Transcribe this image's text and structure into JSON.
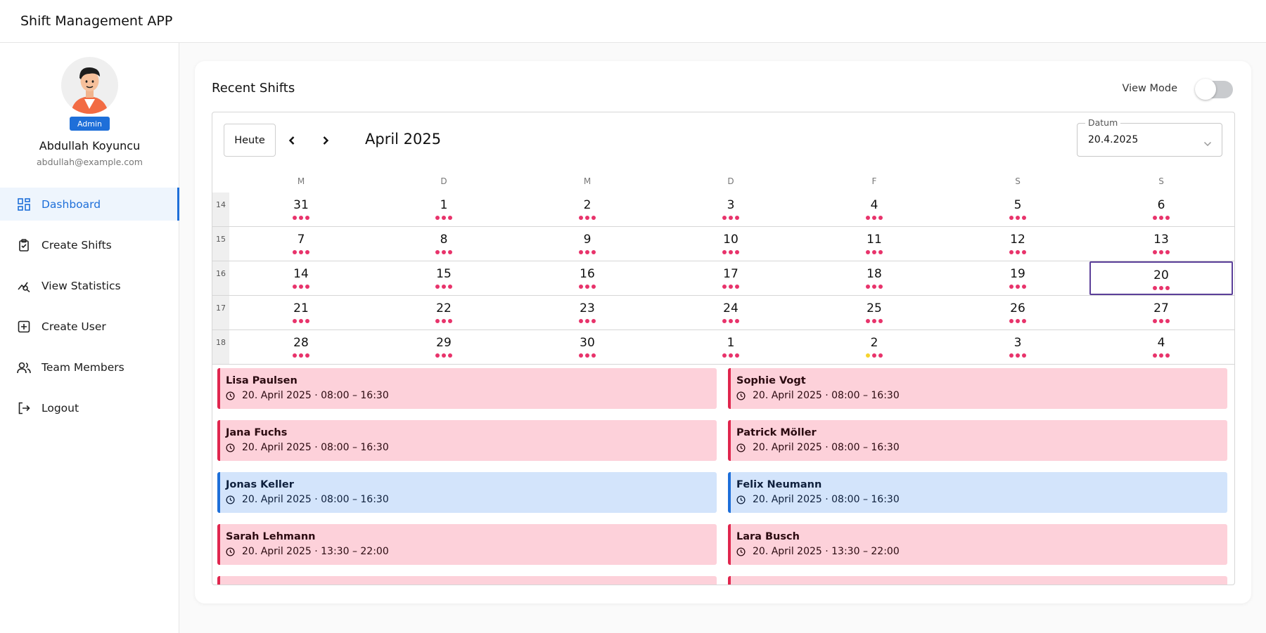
{
  "app": {
    "title": "Shift Management APP"
  },
  "user": {
    "name": "Abdullah Koyuncu",
    "email": "abdullah@example.com",
    "role": "Admin"
  },
  "nav": [
    {
      "label": "Dashboard",
      "icon": "dashboard-icon",
      "active": true
    },
    {
      "label": "Create Shifts",
      "icon": "clipboard-check-icon"
    },
    {
      "label": "View Statistics",
      "icon": "statistics-icon"
    },
    {
      "label": "Create User",
      "icon": "add-box-icon"
    },
    {
      "label": "Team Members",
      "icon": "team-icon"
    },
    {
      "label": "Logout",
      "icon": "logout-icon"
    }
  ],
  "card": {
    "title": "Recent Shifts",
    "view_mode_label": "View Mode",
    "view_mode_on": false
  },
  "calendar": {
    "today_label": "Heute",
    "month_label": "April 2025",
    "date_field": {
      "label": "Datum",
      "value": "20.4.2025"
    },
    "weekdays": [
      "M",
      "D",
      "M",
      "D",
      "F",
      "S",
      "S"
    ],
    "weeks": [
      {
        "number": "14",
        "days": [
          "31",
          "1",
          "2",
          "3",
          "4",
          "5",
          "6"
        ]
      },
      {
        "number": "15",
        "days": [
          "7",
          "8",
          "9",
          "10",
          "11",
          "12",
          "13"
        ]
      },
      {
        "number": "16",
        "days": [
          "14",
          "15",
          "16",
          "17",
          "18",
          "19",
          "20"
        ]
      },
      {
        "number": "17",
        "days": [
          "21",
          "22",
          "23",
          "24",
          "25",
          "26",
          "27"
        ]
      },
      {
        "number": "18",
        "days": [
          "28",
          "29",
          "30",
          "1",
          "2",
          "3",
          "4"
        ]
      }
    ],
    "selected": "20",
    "accent_color": "#5b3f99",
    "dot_color": "#e8336b",
    "dot_alt_color": "#f6d32d"
  },
  "shifts": [
    {
      "name": "Lisa Paulsen",
      "time": "20. April 2025 · 08:00 – 16:30",
      "color": "pink"
    },
    {
      "name": "Sophie Vogt",
      "time": "20. April 2025 · 08:00 – 16:30",
      "color": "pink"
    },
    {
      "name": "Jana Fuchs",
      "time": "20. April 2025 · 08:00 – 16:30",
      "color": "pink"
    },
    {
      "name": "Patrick Möller",
      "time": "20. April 2025 · 08:00 – 16:30",
      "color": "pink"
    },
    {
      "name": "Jonas Keller",
      "time": "20. April 2025 · 08:00 – 16:30",
      "color": "blue"
    },
    {
      "name": "Felix Neumann",
      "time": "20. April 2025 · 08:00 – 16:30",
      "color": "blue"
    },
    {
      "name": "Sarah Lehmann",
      "time": "20. April 2025 · 13:30 – 22:00",
      "color": "pink"
    },
    {
      "name": "Lara Busch",
      "time": "20. April 2025 · 13:30 – 22:00",
      "color": "pink"
    }
  ]
}
